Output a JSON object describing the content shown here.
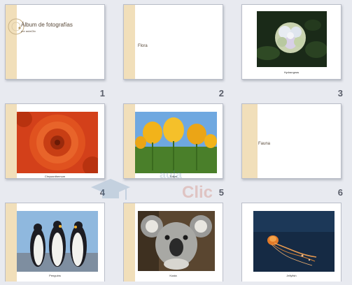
{
  "slides": [
    {
      "number": "1",
      "title": "Álbum de fotografías",
      "subtitle": "por aulaClic"
    },
    {
      "number": "2",
      "title": "Flora"
    },
    {
      "number": "3",
      "caption": "Hydrangeas"
    },
    {
      "number": "4",
      "caption": "Chrysanthemum"
    },
    {
      "number": "5",
      "caption": "Tulips"
    },
    {
      "number": "6",
      "title": "Fauna"
    },
    {
      "caption": "Penguins"
    },
    {
      "caption": "Koala"
    },
    {
      "caption": "Jellyfish"
    }
  ],
  "watermark": {
    "line1": "aula",
    "line2": "Clic"
  },
  "colors": {
    "accent_bar": "#f1dfba",
    "background": "#e8eaf0"
  }
}
